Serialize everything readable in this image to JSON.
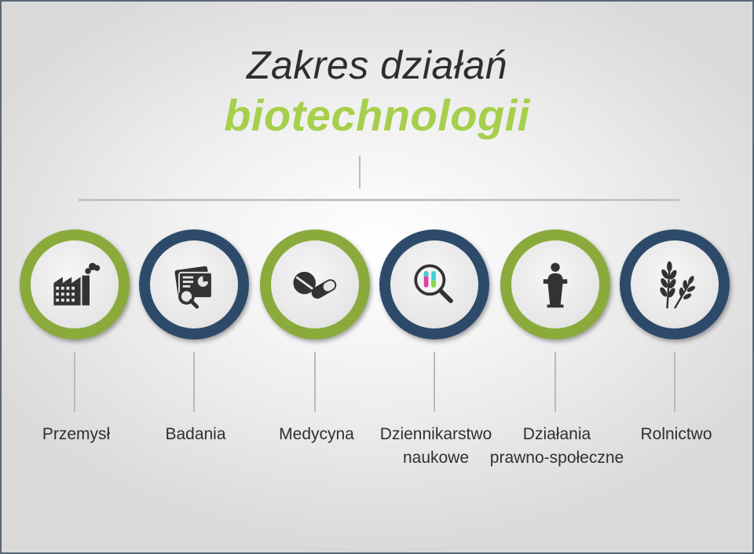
{
  "header": {
    "title_line1": "Zakres działań",
    "title_line2": "biotechnologii"
  },
  "colors": {
    "green": "#8aab3c",
    "navy": "#2e4a6b",
    "title_accent": "#a6cf4b",
    "title_text": "#2e2e2e"
  },
  "items": [
    {
      "label": "Przemysł",
      "ring": "green",
      "icon": "factory-icon"
    },
    {
      "label": "Badania",
      "ring": "navy",
      "icon": "research-documents-icon"
    },
    {
      "label": "Medycyna",
      "ring": "green",
      "icon": "pills-icon"
    },
    {
      "label": "Dziennikarstwo\nnaukowe",
      "ring": "navy",
      "icon": "magnifier-test-tubes-icon"
    },
    {
      "label": "Działania\nprawno-społeczne",
      "ring": "green",
      "icon": "speaker-podium-icon"
    },
    {
      "label": "Rolnictwo",
      "ring": "navy",
      "icon": "wheat-icon"
    }
  ]
}
